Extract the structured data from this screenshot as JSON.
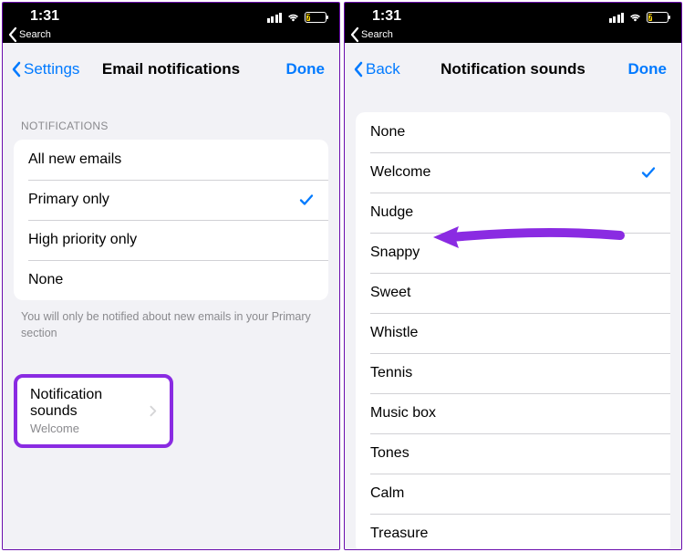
{
  "accent_color": "#007aff",
  "highlight_color": "#8a2be2",
  "statusbar": {
    "time": "1:31",
    "back_label": "Search",
    "battery_text": "7"
  },
  "left_screen": {
    "nav": {
      "back": "Settings",
      "title": "Email notifications",
      "done": "Done"
    },
    "section_label": "NOTIFICATIONS",
    "options": [
      {
        "label": "All new emails",
        "selected": false
      },
      {
        "label": "Primary only",
        "selected": true
      },
      {
        "label": "High priority only",
        "selected": false
      },
      {
        "label": "None",
        "selected": false
      }
    ],
    "footer": "You will only be notified about new emails in your Primary section",
    "sounds": {
      "title": "Notification sounds",
      "value": "Welcome"
    }
  },
  "right_screen": {
    "nav": {
      "back": "Back",
      "title": "Notification sounds",
      "done": "Done"
    },
    "options": [
      {
        "label": "None",
        "selected": false
      },
      {
        "label": "Welcome",
        "selected": true
      },
      {
        "label": "Nudge",
        "selected": false
      },
      {
        "label": "Snappy",
        "selected": false
      },
      {
        "label": "Sweet",
        "selected": false
      },
      {
        "label": "Whistle",
        "selected": false
      },
      {
        "label": "Tennis",
        "selected": false
      },
      {
        "label": "Music box",
        "selected": false
      },
      {
        "label": "Tones",
        "selected": false
      },
      {
        "label": "Calm",
        "selected": false
      },
      {
        "label": "Treasure",
        "selected": false
      }
    ]
  }
}
